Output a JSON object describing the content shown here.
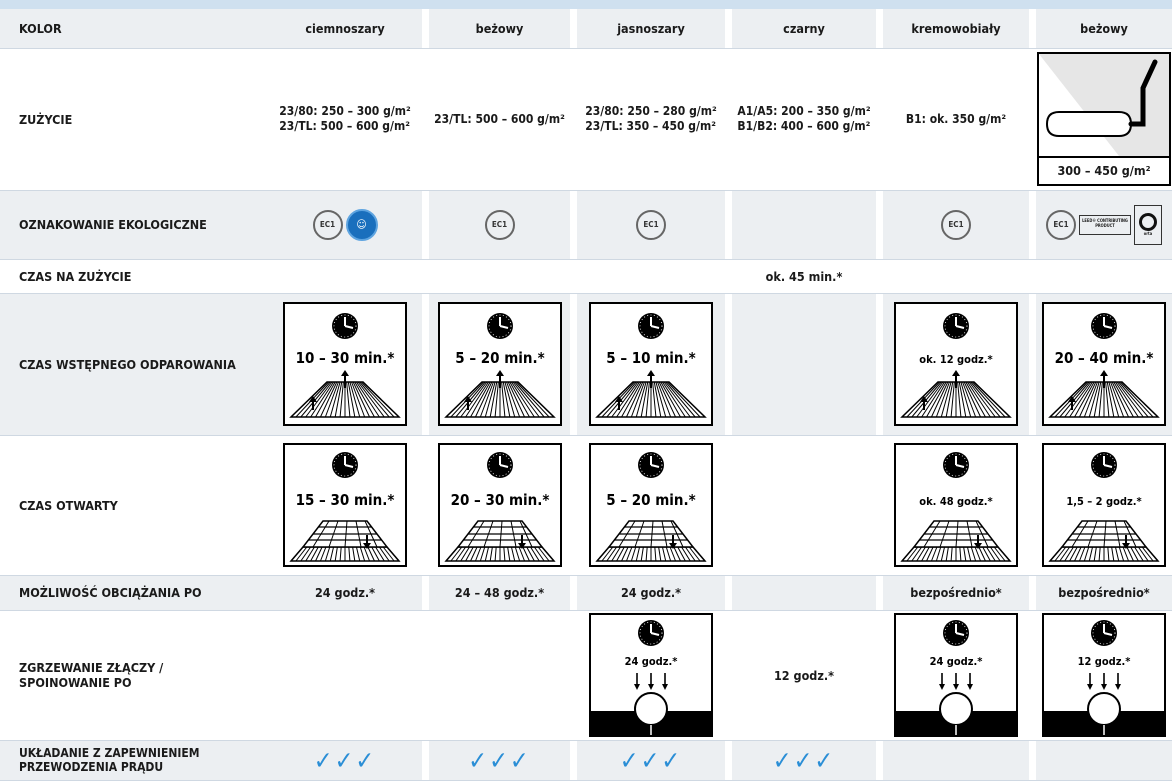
{
  "columns": [
    "ciemnoszary",
    "beżowy",
    "jasnoszary",
    "czarny",
    "kremowobiały",
    "beżowy"
  ],
  "rows": {
    "kolor": {
      "label": "KOLOR"
    },
    "zuzycie": {
      "label": "ZUŻYCIE",
      "c0": [
        "23/80: 250 – 300 g/m²",
        "23/TL: 500 – 600 g/m²"
      ],
      "c1": [
        "23/TL: 500 – 600 g/m²"
      ],
      "c2": [
        "23/80: 250 – 280 g/m²",
        "23/TL: 350 – 450 g/m²"
      ],
      "c3": [
        "A1/A5: 200 – 350 g/m²",
        "B1/B2: 400 – 600 g/m²"
      ],
      "c4": [
        "B1: ok. 350 g/m²"
      ],
      "c5": "300 – 450 g/m²"
    },
    "eko": {
      "label": "OZNAKOWANIE EKOLOGICZNE",
      "badge_emicode": "EC1",
      "badge_blue_angel": "",
      "leed_text": "LEED® CONTRIBUTING PRODUCT",
      "gear_text": "orta"
    },
    "czas_zuzycie": {
      "label": "CZAS NA ZUŻYCIE",
      "c3": "ok. 45 min.*"
    },
    "odparowanie": {
      "label": "CZAS WSTĘPNEGO ODPAROWANIA",
      "values": [
        "10 – 30 min.*",
        "5 – 20 min.*",
        "5 – 10 min.*",
        "",
        "ok. 12 godz.*",
        "20 – 40 min.*"
      ]
    },
    "otwarty": {
      "label": "CZAS OTWARTY",
      "values": [
        "15 – 30 min.*",
        "20 – 30 min.*",
        "5 – 20 min.*",
        "",
        "ok. 48 godz.*",
        "1,5 – 2 godz.*"
      ]
    },
    "obciazanie": {
      "label": "MOŻLIWOŚĆ OBCIĄŻANIA PO",
      "values": [
        "24 godz.*",
        "24 – 48 godz.*",
        "24 godz.*",
        "",
        "bezpośrednio*",
        "bezpośrednio*"
      ]
    },
    "zgrzewanie": {
      "label_line1": "ZGRZEWANIE ZŁĄCZY /",
      "label_line2": "SPOINOWANIE PO",
      "values": [
        "",
        "",
        "24 godz.*",
        "12 godz.*",
        "24 godz.*",
        "12 godz.*"
      ]
    },
    "ukladanie": {
      "label_line1": "UKŁADANIE Z ZAPEWNIENIEM",
      "label_line2": "PRZEWODZENIA PRĄDU",
      "tick": "✓✓✓"
    }
  },
  "colors": {
    "shade": "#eceff2",
    "topbar": "#cfe0ef",
    "tick": "#2a8ed6",
    "blue_angel": "#1a6fbd"
  }
}
